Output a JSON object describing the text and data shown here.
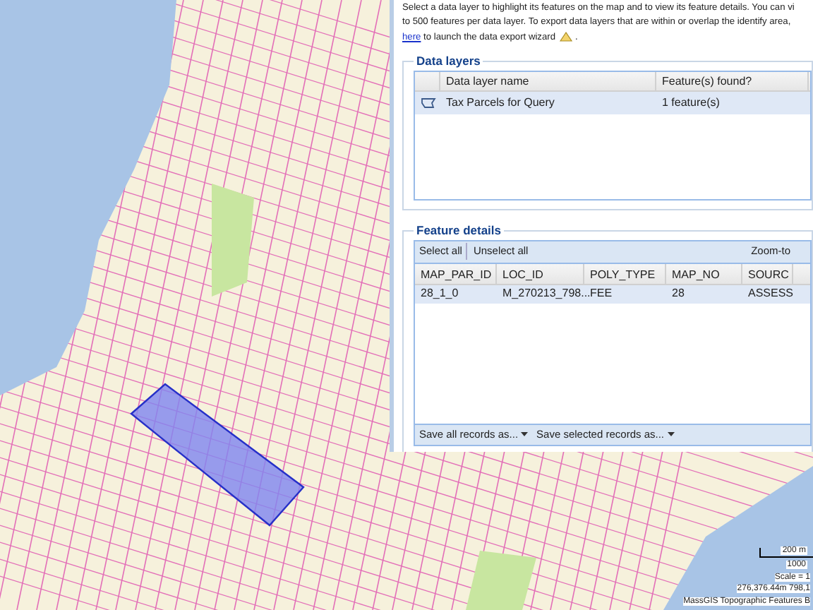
{
  "intro": {
    "lines": [
      "Select a data layer to highlight its features on the map and to view its feature details. You can vi",
      "to 500 features per data layer. To export data layers that are within or overlap the identify area,"
    ],
    "link": "here",
    "after_link": " to launch the data export wizard",
    "end": "."
  },
  "data_layers": {
    "legend": "Data layers",
    "columns": [
      "Data layer name",
      "Feature(s) found?"
    ],
    "rows": [
      {
        "name": "Tax Parcels for Query",
        "found": "1 feature(s)",
        "selected": true
      }
    ]
  },
  "feature_details": {
    "legend": "Feature details",
    "toolbar": {
      "select_all": "Select all",
      "unselect_all": "Unselect all",
      "zoom_to": "Zoom-to"
    },
    "columns": [
      "MAP_PAR_ID",
      "LOC_ID",
      "POLY_TYPE",
      "MAP_NO",
      "SOURC"
    ],
    "rows": [
      {
        "cells": [
          "28_1_0",
          "M_270213_798...",
          "FEE",
          "28",
          "ASSESS"
        ],
        "selected": true
      }
    ],
    "footer": [
      "Save all records as...",
      "Save selected records as..."
    ]
  },
  "map": {
    "scale_distance": "200 m",
    "scale_feet": "1000",
    "scale_ratio": "Scale = 1",
    "coordinates": "276,376.44m 798,1",
    "layer_credit": "MassGIS Topographic Features B"
  }
}
